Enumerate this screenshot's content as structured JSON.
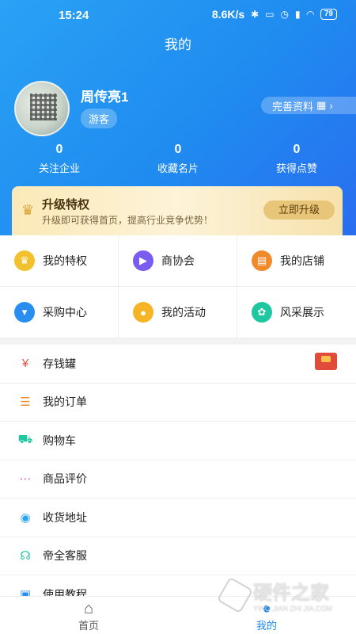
{
  "status_bar": {
    "time": "15:24",
    "speed": "8.6K/s",
    "battery": "79"
  },
  "page_title": "我的",
  "user": {
    "name": "周传亮1",
    "role": "游客",
    "complete_profile": "完善资料"
  },
  "stats": [
    {
      "value": "0",
      "label": "关注企业"
    },
    {
      "value": "0",
      "label": "收藏名片"
    },
    {
      "value": "0",
      "label": "获得点赞"
    }
  ],
  "vip": {
    "title": "升级特权",
    "subtitle": "升级即可获得首页，提高行业竞争优势！",
    "button": "立即升级"
  },
  "grid": [
    {
      "label": "我的特权",
      "icon": "crown-icon",
      "color": "#f2c12e"
    },
    {
      "label": "商协会",
      "icon": "flag-icon",
      "color": "#7b5cf0"
    },
    {
      "label": "我的店铺",
      "icon": "store-icon",
      "color": "#f08a2a"
    },
    {
      "label": "采购中心",
      "icon": "basket-icon",
      "color": "#2a8ef0"
    },
    {
      "label": "我的活动",
      "icon": "chat-icon",
      "color": "#f5b524"
    },
    {
      "label": "风采展示",
      "icon": "display-icon",
      "color": "#1ec7a0"
    }
  ],
  "list": [
    {
      "label": "存钱罐",
      "icon": "piggy-bank-icon",
      "color": "#e0503f"
    },
    {
      "label": "我的订单",
      "icon": "order-icon",
      "color": "#f08a2a"
    },
    {
      "label": "购物车",
      "icon": "cart-icon",
      "color": "#1ec7a0"
    },
    {
      "label": "商品评价",
      "icon": "comment-icon",
      "color": "#e05aa0"
    },
    {
      "label": "收货地址",
      "icon": "location-icon",
      "color": "#2aa2f5"
    },
    {
      "label": "帝全客服",
      "icon": "headset-icon",
      "color": "#1ec7a0"
    },
    {
      "label": "使用教程",
      "icon": "tutorial-icon",
      "color": "#2a8ef0"
    }
  ],
  "tabs": [
    {
      "label": "首页",
      "icon": "home-icon"
    },
    {
      "label": "我的",
      "icon": "user-icon"
    }
  ],
  "watermark": {
    "text": "硬件之家",
    "sub": "YING JIAN ZHI JIA.COM"
  }
}
